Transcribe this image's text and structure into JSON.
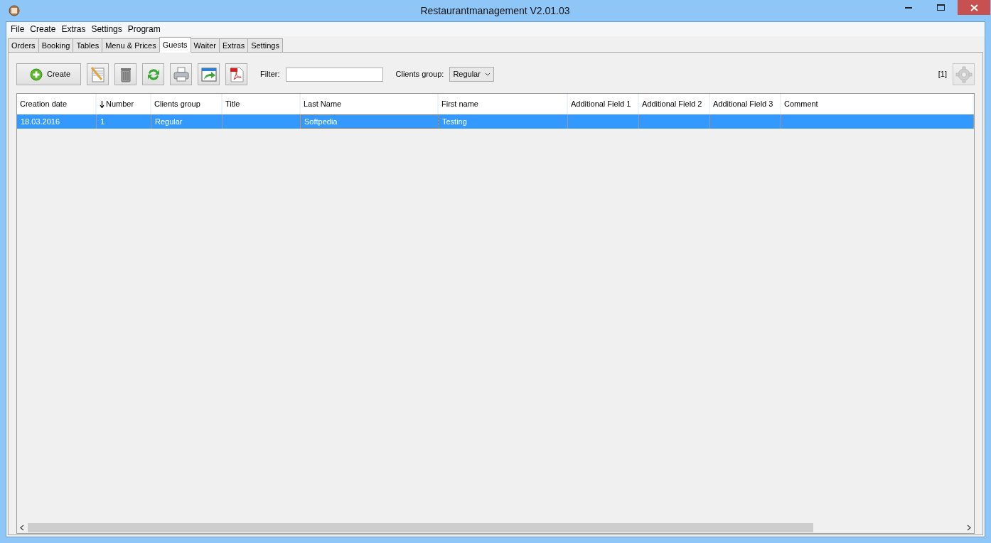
{
  "window": {
    "title": "Restaurantmanagement V2.01.03"
  },
  "menu": [
    "File",
    "Create",
    "Extras",
    "Settings",
    "Program"
  ],
  "tabs": [
    {
      "label": "Orders",
      "selected": false
    },
    {
      "label": "Booking",
      "selected": false
    },
    {
      "label": "Tables",
      "selected": false
    },
    {
      "label": "Menu & Prices",
      "selected": false
    },
    {
      "label": "Guests",
      "selected": true
    },
    {
      "label": "Waiter",
      "selected": false
    },
    {
      "label": "Extras",
      "selected": false
    },
    {
      "label": "Settings",
      "selected": false
    }
  ],
  "toolbar": {
    "create_label": "Create",
    "icons": [
      {
        "kind": "edit"
      },
      {
        "kind": "delete"
      },
      {
        "kind": "refresh"
      },
      {
        "kind": "print"
      },
      {
        "kind": "export"
      },
      {
        "kind": "pdf"
      }
    ],
    "filter_label": "Filter:",
    "group_label": "Clients group:",
    "group_value": "Regular",
    "count": "[1]"
  },
  "table": {
    "columns": [
      {
        "label": "Creation date",
        "sorted": false
      },
      {
        "label": "Number",
        "sorted": true
      },
      {
        "label": "Clients group",
        "sorted": false
      },
      {
        "label": "Title",
        "sorted": false
      },
      {
        "label": "Last Name",
        "sorted": false
      },
      {
        "label": "First name",
        "sorted": false
      },
      {
        "label": "Additional Field 1",
        "sorted": false
      },
      {
        "label": "Additional Field 2",
        "sorted": false
      },
      {
        "label": "Additional Field 3",
        "sorted": false
      },
      {
        "label": "Comment",
        "sorted": false
      }
    ],
    "rows": [
      {
        "selected": true,
        "cells": [
          {
            "text": "18.03.2016",
            "focused": false
          },
          {
            "text": "1",
            "focused": false
          },
          {
            "text": "Regular",
            "focused": false
          },
          {
            "text": "",
            "focused": false
          },
          {
            "text": "Softpedia",
            "focused": true
          },
          {
            "text": "Testing",
            "focused": false
          },
          {
            "text": "",
            "focused": false
          },
          {
            "text": "",
            "focused": false
          },
          {
            "text": "",
            "focused": false
          },
          {
            "text": "",
            "focused": false
          }
        ]
      }
    ]
  }
}
